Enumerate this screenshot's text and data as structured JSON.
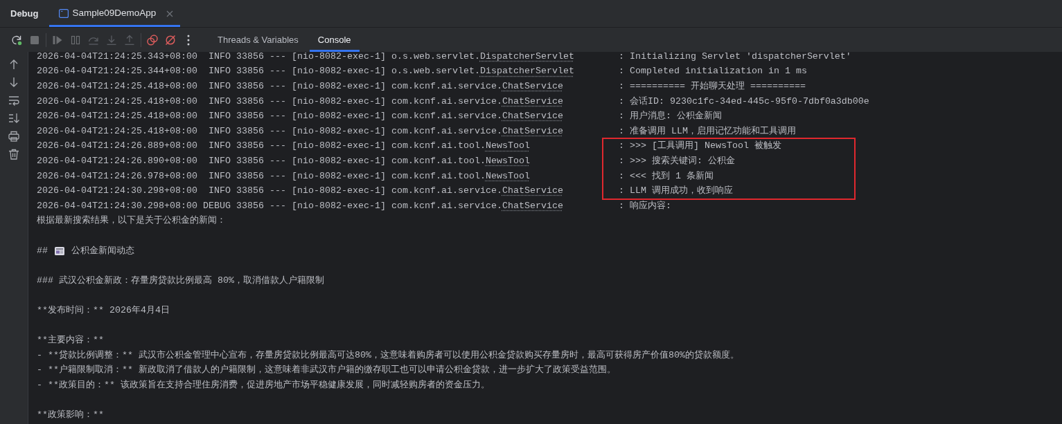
{
  "panel": {
    "title": "Debug"
  },
  "session_tabs": [
    {
      "label": "Sample09DemoApp",
      "selected": true,
      "closable": true
    }
  ],
  "toolbar": {
    "groups": [
      [
        {
          "kind": "rerun",
          "disabled": false
        },
        {
          "kind": "stop",
          "disabled": true
        }
      ],
      [
        {
          "kind": "resume",
          "disabled": true
        },
        {
          "kind": "pause",
          "disabled": true
        },
        {
          "kind": "step_over",
          "disabled": true
        },
        {
          "kind": "step_into",
          "disabled": true
        },
        {
          "kind": "step_out",
          "disabled": true
        }
      ],
      [
        {
          "kind": "view_breakpoints",
          "disabled": false
        },
        {
          "kind": "mute_breakpoints",
          "disabled": false
        },
        {
          "kind": "more",
          "disabled": false
        }
      ]
    ]
  },
  "view_tabs": [
    {
      "label": "Threads & Variables",
      "selected": false
    },
    {
      "label": "Console",
      "selected": true
    }
  ],
  "console_toolbar": [
    {
      "kind": "up"
    },
    {
      "kind": "down"
    },
    {
      "kind": "soft_wrap"
    },
    {
      "kind": "scroll_to_end"
    },
    {
      "kind": "print"
    },
    {
      "kind": "clear"
    }
  ],
  "log": [
    {
      "timestamp": "2026-04-04T21:24:25.343+08:00",
      "level": "INFO",
      "pid": "33856",
      "separator": "---",
      "thread": "[nio-8082-exec-1]",
      "logger": "o.s.web.servlet.",
      "logger_class": "DispatcherServlet",
      "message": ": Initializing Servlet 'dispatcherServlet'",
      "highlighted": false
    },
    {
      "timestamp": "2026-04-04T21:24:25.344+08:00",
      "level": "INFO",
      "pid": "33856",
      "separator": "---",
      "thread": "[nio-8082-exec-1]",
      "logger": "o.s.web.servlet.",
      "logger_class": "DispatcherServlet",
      "message": ": Completed initialization in 1 ms",
      "highlighted": false
    },
    {
      "timestamp": "2026-04-04T21:24:25.418+08:00",
      "level": "INFO",
      "pid": "33856",
      "separator": "---",
      "thread": "[nio-8082-exec-1]",
      "logger": "com.kcnf.ai.service.",
      "logger_class": "ChatService",
      "message": ": ========== 开始聊天处理 ==========",
      "highlighted": false
    },
    {
      "timestamp": "2026-04-04T21:24:25.418+08:00",
      "level": "INFO",
      "pid": "33856",
      "separator": "---",
      "thread": "[nio-8082-exec-1]",
      "logger": "com.kcnf.ai.service.",
      "logger_class": "ChatService",
      "message": ": 会话ID: 9230c1fc-34ed-445c-95f0-7dbf0a3db00e",
      "highlighted": false
    },
    {
      "timestamp": "2026-04-04T21:24:25.418+08:00",
      "level": "INFO",
      "pid": "33856",
      "separator": "---",
      "thread": "[nio-8082-exec-1]",
      "logger": "com.kcnf.ai.service.",
      "logger_class": "ChatService",
      "message": ": 用户消息: 公积金新闻",
      "highlighted": false
    },
    {
      "timestamp": "2026-04-04T21:24:25.418+08:00",
      "level": "INFO",
      "pid": "33856",
      "separator": "---",
      "thread": "[nio-8082-exec-1]",
      "logger": "com.kcnf.ai.service.",
      "logger_class": "ChatService",
      "message": ": 准备调用 LLM，启用记忆功能和工具调用",
      "highlighted": false
    },
    {
      "timestamp": "2026-04-04T21:24:26.889+08:00",
      "level": "INFO",
      "pid": "33856",
      "separator": "---",
      "thread": "[nio-8082-exec-1]",
      "logger": "com.kcnf.ai.tool.",
      "logger_class": "NewsTool",
      "message": ": >>> [工具调用] NewsTool 被触发",
      "highlighted": true
    },
    {
      "timestamp": "2026-04-04T21:24:26.890+08:00",
      "level": "INFO",
      "pid": "33856",
      "separator": "---",
      "thread": "[nio-8082-exec-1]",
      "logger": "com.kcnf.ai.tool.",
      "logger_class": "NewsTool",
      "message": ": >>> 搜索关键词: 公积金",
      "highlighted": true
    },
    {
      "timestamp": "2026-04-04T21:24:26.978+08:00",
      "level": "INFO",
      "pid": "33856",
      "separator": "---",
      "thread": "[nio-8082-exec-1]",
      "logger": "com.kcnf.ai.tool.",
      "logger_class": "NewsTool",
      "message": ": <<< 找到 1 条新闻",
      "highlighted": true
    },
    {
      "timestamp": "2026-04-04T21:24:30.298+08:00",
      "level": "INFO",
      "pid": "33856",
      "separator": "---",
      "thread": "[nio-8082-exec-1]",
      "logger": "com.kcnf.ai.service.",
      "logger_class": "ChatService",
      "message": ": LLM 调用成功，收到响应",
      "highlighted": true
    },
    {
      "timestamp": "2026-04-04T21:24:30.298+08:00",
      "level": "DEBUG",
      "pid": "33856",
      "separator": "---",
      "thread": "[nio-8082-exec-1]",
      "logger": "com.kcnf.ai.service.",
      "logger_class": "ChatService",
      "message": ": 响应内容:",
      "highlighted": false
    }
  ],
  "response": [
    {
      "lines": [
        {
          "kind": "text",
          "text": "根据最新搜索结果，以下是关于公积金的新闻："
        }
      ]
    },
    {
      "lines": [
        {
          "kind": "heading_icon",
          "marker": "##",
          "text": "公积金新闻动态"
        }
      ]
    },
    {
      "lines": [
        {
          "kind": "text",
          "text": "### 武汉公积金新政：存量房贷款比例最高 80%，取消借款人户籍限制"
        }
      ]
    },
    {
      "lines": [
        {
          "kind": "text",
          "text": "**发布时间：** 2026年4月4日"
        }
      ]
    },
    {
      "lines": [
        {
          "kind": "text",
          "text": "**主要内容：**"
        },
        {
          "kind": "text",
          "text": "- **贷款比例调整：** 武汉市公积金管理中心宣布，存量房贷款比例最高可达80%，这意味着购房者可以使用公积金贷款购买存量房时，最高可获得房产价值80%的贷款额度。"
        },
        {
          "kind": "text",
          "text": "- **户籍限制取消：** 新政取消了借款人的户籍限制，这意味着非武汉市户籍的缴存职工也可以申请公积金贷款，进一步扩大了政策受益范围。"
        },
        {
          "kind": "text",
          "text": "- **政策目的：** 该政策旨在支持合理住房消费，促进房地产市场平稳健康发展，同时减轻购房者的资金压力。"
        }
      ]
    },
    {
      "lines": [
        {
          "kind": "text",
          "text": "**政策影响：**"
        }
      ]
    }
  ]
}
